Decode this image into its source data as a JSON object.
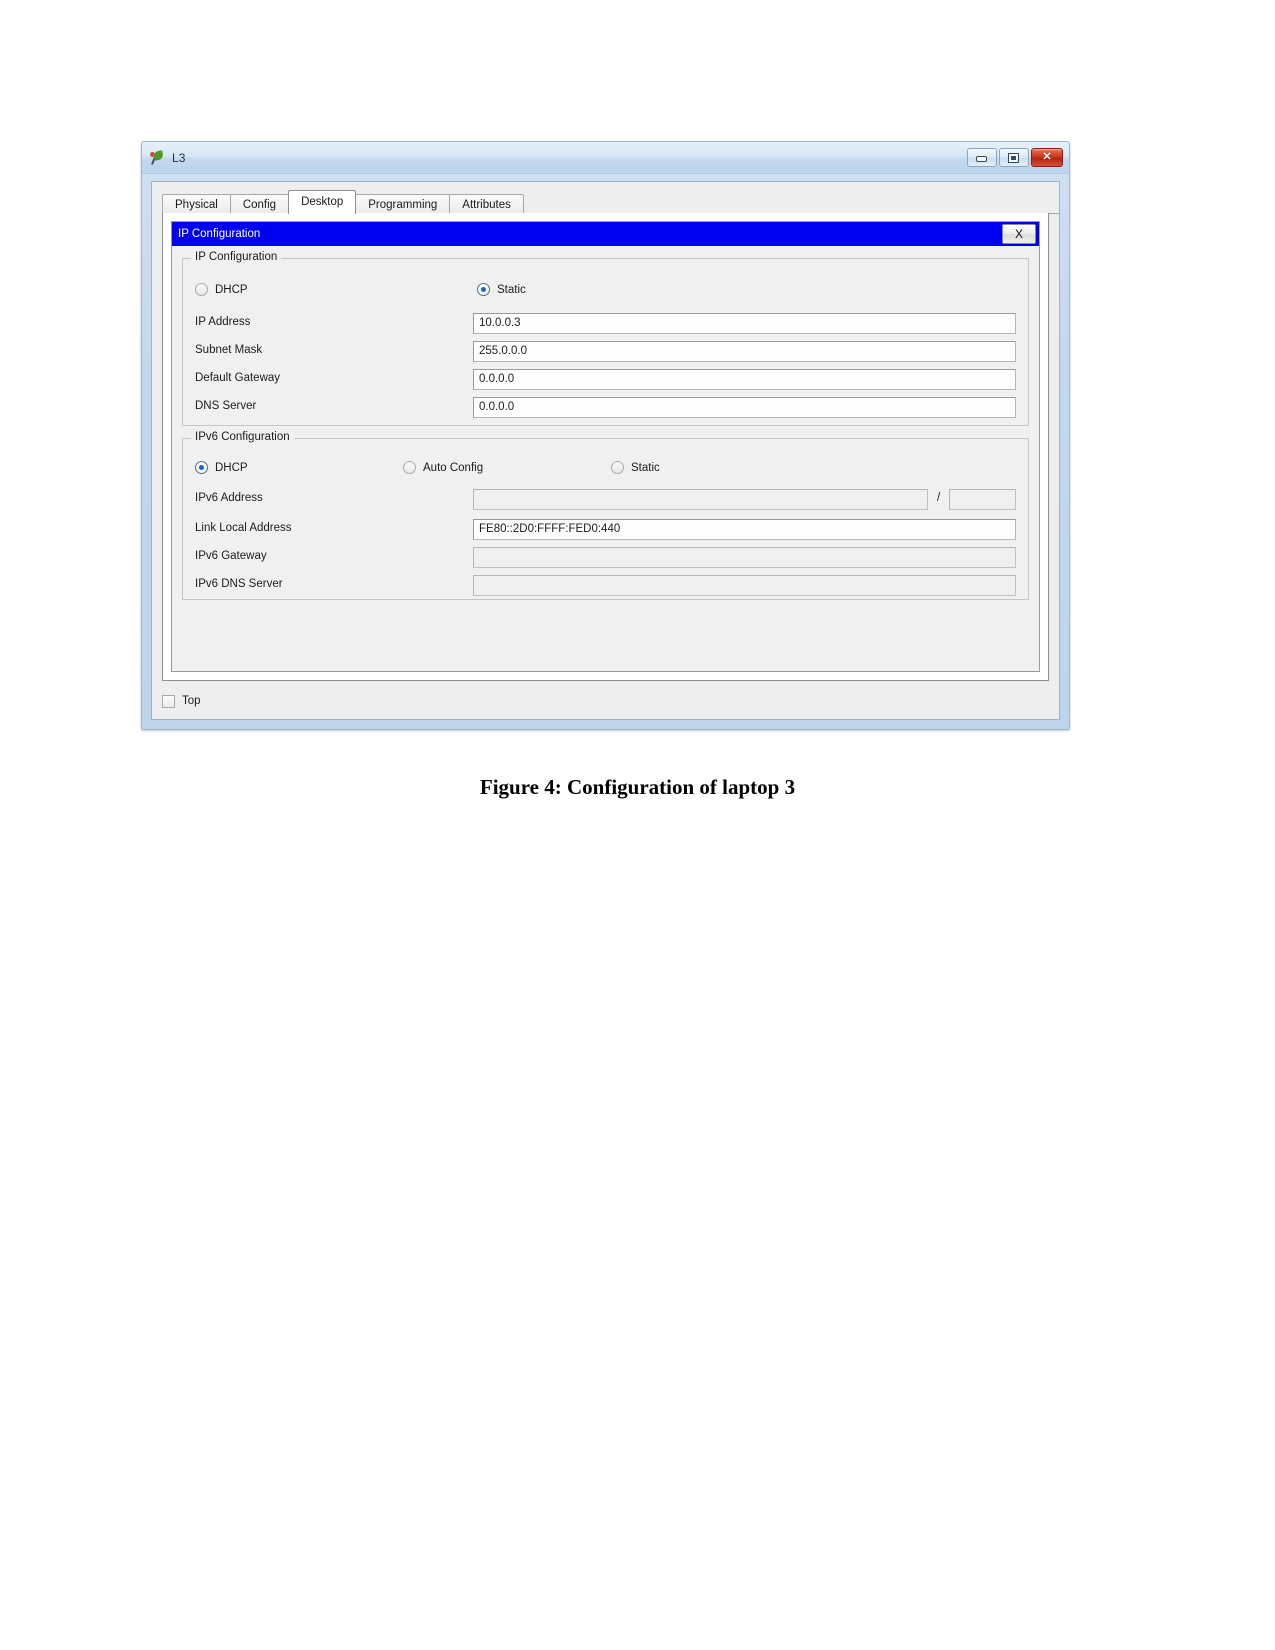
{
  "window": {
    "title": "L3",
    "icon": "packet-tracer-icon",
    "controls": {
      "minimize": "minimize-icon",
      "maximize": "maximize-icon",
      "close": "✕"
    }
  },
  "tabs": [
    {
      "label": "Physical",
      "active": false
    },
    {
      "label": "Config",
      "active": false
    },
    {
      "label": "Desktop",
      "active": true
    },
    {
      "label": "Programming",
      "active": false
    },
    {
      "label": "Attributes",
      "active": false
    }
  ],
  "dialog": {
    "title": "IP Configuration",
    "close_label": "X"
  },
  "ipv4": {
    "legend": "IP Configuration",
    "mode_options": [
      {
        "label": "DHCP",
        "selected": false
      },
      {
        "label": "Static",
        "selected": true
      }
    ],
    "fields": [
      {
        "label": "IP Address",
        "value": "10.0.0.3",
        "disabled": false
      },
      {
        "label": "Subnet Mask",
        "value": "255.0.0.0",
        "disabled": false
      },
      {
        "label": "Default Gateway",
        "value": "0.0.0.0",
        "disabled": false
      },
      {
        "label": "DNS Server",
        "value": "0.0.0.0",
        "disabled": false
      }
    ]
  },
  "ipv6": {
    "legend": "IPv6 Configuration",
    "mode_options": [
      {
        "label": "DHCP",
        "selected": true
      },
      {
        "label": "Auto Config",
        "selected": false
      },
      {
        "label": "Static",
        "selected": false
      }
    ],
    "address_label": "IPv6 Address",
    "address_value": "",
    "prefix_value": "",
    "separator": "/",
    "fields": [
      {
        "label": "Link Local Address",
        "value": "FE80::2D0:FFFF:FED0:440",
        "disabled": false
      },
      {
        "label": "IPv6 Gateway",
        "value": "",
        "disabled": true
      },
      {
        "label": "IPv6 DNS Server",
        "value": "",
        "disabled": true
      }
    ]
  },
  "bottom": {
    "top_label": "Top",
    "top_checked": false
  },
  "caption": "Figure 4: Configuration of laptop 3",
  "colors": {
    "dialog_title_bg": "#0000F0",
    "radio_dot": "#1566C0",
    "close_button": "#C8301A"
  }
}
